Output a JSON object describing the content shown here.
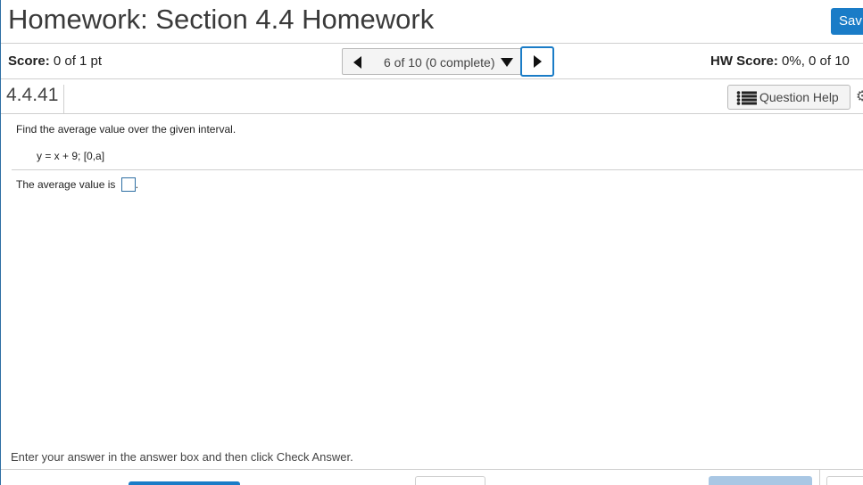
{
  "header": {
    "title": "Homework: Section 4.4 Homework",
    "save_label": "Sav"
  },
  "score_bar": {
    "score_label": "Score:",
    "score_value": " 0 of 1 pt",
    "nav_progress": "6 of 10 (0 complete)",
    "hw_score_label": "HW Score:",
    "hw_score_value": " 0%, 0 of 10 "
  },
  "question_bar": {
    "number": "4.4.41",
    "help_label": "Question Help"
  },
  "question": {
    "instruction": "Find the average value over the given interval.",
    "equation": "y = x + 9; [0,a]",
    "answer_prefix": "The average value is ",
    "answer_suffix": ".",
    "answer_value": ""
  },
  "footer": {
    "note": "Enter your answer in the answer box and then click Check Answer."
  },
  "colors": {
    "accent_blue": "#1a7cc7",
    "check_button_disabled": "#a9c7e4"
  }
}
